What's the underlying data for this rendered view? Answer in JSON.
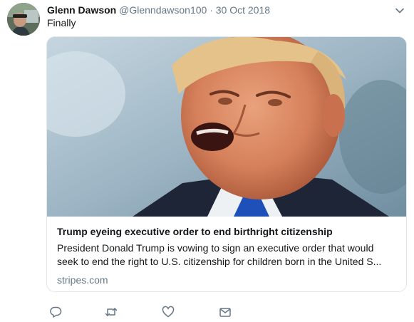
{
  "tweet": {
    "author_name": "Glenn Dawson",
    "author_handle": "@Glenndawson100",
    "separator": "·",
    "date": "30 Oct 2018",
    "text": "Finally"
  },
  "card": {
    "title": "Trump eyeing executive order to end birthright citizenship",
    "description": "President Donald Trump is vowing to sign an executive order that would seek to end the right to U.S. citizenship for children born in the United S...",
    "domain": "stripes.com"
  },
  "icons": {
    "menu": "chevron-down-icon",
    "reply": "reply-icon",
    "retweet": "retweet-icon",
    "like": "heart-icon",
    "message": "envelope-icon"
  },
  "colors": {
    "secondary_text": "#657786",
    "border": "#e1e8ed",
    "primary_text": "#14171a"
  }
}
